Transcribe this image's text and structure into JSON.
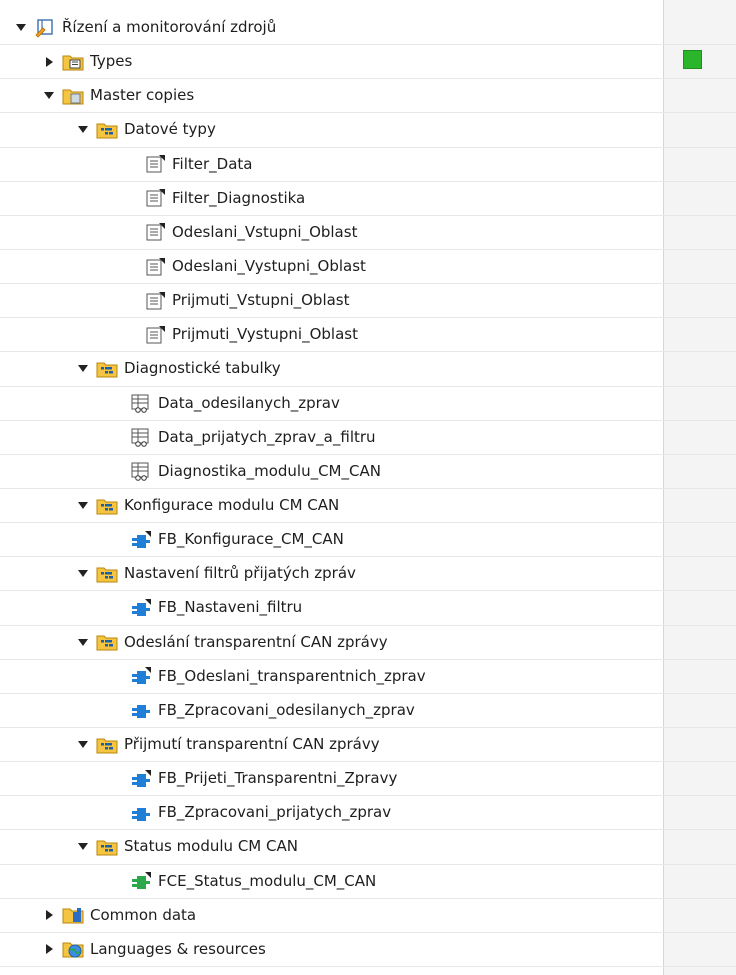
{
  "tree": {
    "root": "Řízení a monitorování zdrojů",
    "types": "Types",
    "master_copies": "Master copies",
    "folders": [
      {
        "label": "Datové typy",
        "items": [
          "Filter_Data",
          "Filter_Diagnostika",
          "Odeslani_Vstupni_Oblast",
          "Odeslani_Vystupni_Oblast",
          "Prijmuti_Vstupni_Oblast",
          "Prijmuti_Vystupni_Oblast"
        ]
      },
      {
        "label": "Diagnostické tabulky",
        "items": [
          "Data_odesilanych_zprav",
          "Data_prijatych_zprav_a_filtru",
          "Diagnostika_modulu_CM_CAN"
        ]
      },
      {
        "label": "Konfigurace modulu CM CAN",
        "items": [
          "FB_Konfigurace_CM_CAN"
        ]
      },
      {
        "label": "Nastavení filtrů přijatých zpráv",
        "items": [
          "FB_Nastaveni_filtru"
        ]
      },
      {
        "label": "Odeslání transparentní CAN zprávy",
        "items": [
          "FB_Odeslani_transparentnich_zprav",
          "FB_Zpracovani_odesilanych_zprav"
        ]
      },
      {
        "label": "Přijmutí transparentní CAN zprávy",
        "items": [
          "FB_Prijeti_Transparentni_Zpravy",
          "FB_Zpracovani_prijatych_zprav"
        ]
      },
      {
        "label": "Status modulu CM CAN",
        "items": [
          "FCE_Status_modulu_CM_CAN"
        ]
      }
    ],
    "common_data": "Common data",
    "languages": "Languages & resources"
  },
  "colors": {
    "status_green": "#2bb52b",
    "folder_yellow": "#f5c542",
    "fb_blue": "#1f7fd6",
    "fce_green": "#2aa84a"
  }
}
